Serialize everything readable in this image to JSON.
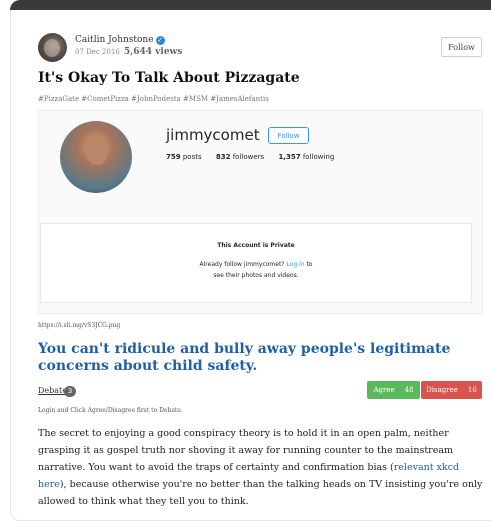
{
  "author": {
    "name": "Caitlin Johnstone",
    "date": "07 Dec 2016",
    "views": "5,644 views",
    "follow_label": "Follow"
  },
  "post": {
    "title": "It's Okay To Talk About Pizzagate",
    "tags": "#PizzaGate #CometPizza #JohnPodesta #MSM #JamesAlefantis"
  },
  "instagram_embed": {
    "username": "jimmycomet",
    "follow_label": "Follow",
    "posts_count": "759",
    "posts_label": "posts",
    "followers_count": "832",
    "followers_label": "followers",
    "following_count": "1,357",
    "following_label": "following",
    "private_title": "This Account is Private",
    "private_line1_prefix": "Already follow jimmycomet?",
    "private_login_link": "Log in",
    "private_line1_suffix": "to",
    "private_line2": "see their photos and videos."
  },
  "image_url": "https://i.sli.mg/vS3JCG.png",
  "headline": "You can't ridicule and bully away people's legitimate concerns about child safety.",
  "debate": {
    "label": "Debate",
    "count": "3",
    "agree_label": "Agree",
    "agree_count": "48",
    "disagree_label": "Disagree",
    "disagree_count": "16",
    "login_note": "Login and Click Agree/Disagree first to Debate."
  },
  "body": {
    "text_before": "The secret to enjoying a good conspiracy theory is to hold it in an open palm, neither grasping it as gospel truth nor shoving it away for running counter to the mainstream narrative. You want to avoid the traps of certainty and confirmation bias (",
    "link_text": "relevant xkcd here",
    "text_after": "), because otherwise you're no better than the talking heads on TV insisting you're only allowed to think what they tell you to think."
  },
  "colors": {
    "headline_blue": "#1f5fa8",
    "agree_green": "#5cb85c",
    "disagree_red": "#d9534f",
    "instagram_blue": "#3897f0",
    "verified_blue": "#2f86d6"
  },
  "icons": {
    "verified": "verified-check-icon"
  }
}
